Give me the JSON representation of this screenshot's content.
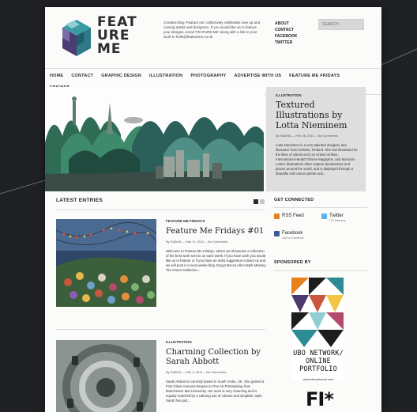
{
  "logo": {
    "lines": [
      "FEAT",
      "URE",
      "ME"
    ]
  },
  "header": {
    "intro": "Creative blog 'Feature me' collectively celebrates new up and coming artists and designers. If you would like us to feature your designs, email 'FEATURE ME' along with a link to your work to hello@featureme.co.uk",
    "top_links": [
      "ABOUT",
      "CONTACT",
      "FACEBOOK",
      "TWITTER"
    ],
    "search_placeholder": "SEARCH"
  },
  "nav": {
    "row1": [
      "HOME",
      "CONTACT",
      "GRAPHIC DESIGN",
      "ILLUSTRATION",
      "PHOTOGRAPHY",
      "ADVERTISE WITH US",
      "FEATURE ME FRIDAYS"
    ],
    "row2": [
      "FRIENDS"
    ]
  },
  "featured": {
    "category": "ILLUSTRATION",
    "title": "Textured Illustrations by Lotta Nieminem",
    "meta": "By SABHA — Feb 28, 2011 – No Comments",
    "excerpt": "Lotta Nieminem is a very talented designer and illustrator from Helsinki, Finland. She has illustrated for the likes of clients such as United Airlines, International Herald Tribune Magazine, and Monocle. Lotta's illustrations often capture destinations and places around the world, and is displayed through a beautiful soft colour palette and..."
  },
  "latest": {
    "heading": "LATEST ENTRIES"
  },
  "posts": [
    {
      "category": "FEATURE ME FRIDAYS",
      "title": "Feature Me Fridays #01",
      "meta": "By SABHA — Mar 11, 2011 – No Comments",
      "excerpt": "Welcome to Feature Me Fridays, where we showcase a collection of the best work sent to us each week. If you have work you would like us to feature or if you have an artist suggestion contact us and we will post it in next weeks blog. Enjoy! Becca Allen Mark Massey Tim Green Katherine..."
    },
    {
      "category": "ILLUSTRATION",
      "title": "Charming Collection by Sarah Abbott",
      "meta": "By SABHA — Mar 3, 2011 – No Comments",
      "excerpt": "Sarah Abbott is currently based in South Yorks, UK. She gained a First Class Honours Degree in Fine Art Printmaking from Manchester Met University. Her work is very charming and is equally matched by a calming use of colours and simplistic style. Sarah has just..."
    }
  ],
  "sidebar": {
    "connected_heading": "GET CONNECTED",
    "rss": {
      "name": "RSS Feed",
      "sub": ""
    },
    "twitter": {
      "name": "Twitter",
      "sub": "170 followers"
    },
    "facebook": {
      "name": "Facebook",
      "sub": "Like on Facebook"
    },
    "sponsored_heading": "SPONSORED BY"
  },
  "ad": {
    "line1": "UBO NETWORK/",
    "line2": "ONLINE PORTFOLIO",
    "url": "www.ubonetwork.com",
    "second_ad": "FI*"
  },
  "colors": {
    "page_bg": "#1f2124",
    "logo_teal": "#2d8b95",
    "logo_purple": "#4a3a6e",
    "feature_panel": "#dedede",
    "rss": "#e8801b",
    "twitter": "#5bb4e6",
    "facebook": "#3b5998"
  }
}
